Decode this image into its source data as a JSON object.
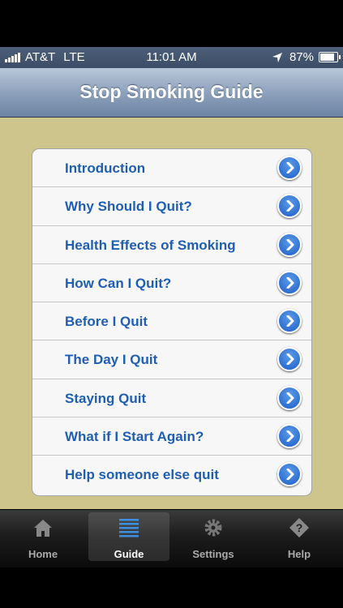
{
  "status": {
    "carrier": "AT&T",
    "network": "LTE",
    "time": "11:01 AM",
    "battery": "87%",
    "battery_level": 0.87
  },
  "nav": {
    "title": "Stop Smoking Guide"
  },
  "menu": [
    {
      "label": "Introduction"
    },
    {
      "label": "Why Should I Quit?"
    },
    {
      "label": "Health Effects of Smoking"
    },
    {
      "label": "How Can I Quit?"
    },
    {
      "label": "Before I Quit"
    },
    {
      "label": "The Day I Quit"
    },
    {
      "label": "Staying Quit"
    },
    {
      "label": "What if I Start Again?"
    },
    {
      "label": "Help someone else quit"
    }
  ],
  "tabs": [
    {
      "label": "Home",
      "icon": "home-icon"
    },
    {
      "label": "Guide",
      "icon": "list-icon",
      "active": true
    },
    {
      "label": "Settings",
      "icon": "gear-icon"
    },
    {
      "label": "Help",
      "icon": "help-icon"
    }
  ],
  "colors": {
    "background": "#cdc58c",
    "link": "#1f5fb3",
    "accent": "#1e5ec8"
  }
}
